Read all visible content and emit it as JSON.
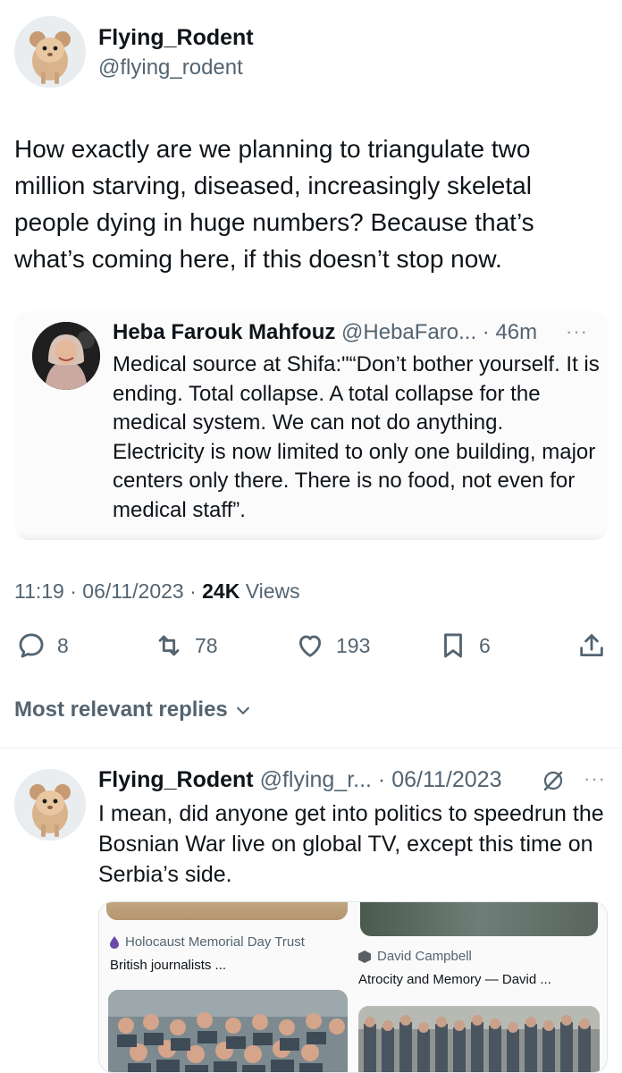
{
  "tweet": {
    "author": {
      "name": "Flying_Rodent",
      "handle": "@flying_rodent"
    },
    "text": "How exactly are we planning to triangulate two million starving, diseased, increasingly skeletal people dying in huge numbers? Because that’s what’s coming here, if this doesn’t stop now.",
    "quoted": {
      "name": "Heba Farouk Mahfouz",
      "meta": "@HebaFaro... · 46m",
      "more": "···",
      "text": "Medical source at Shifa:\"“Don’t bother yourself. It is ending. Total collapse. A total collapse for the medical system. We can not do anything. Electricity is now limited to only one building, major centers only there. There is no food, not even for medical staff”."
    },
    "timestamp": "11:19 · 06/11/2023 · ",
    "views_count": "24K",
    "views_label": " Views",
    "stats": {
      "replies": "8",
      "retweets": "78",
      "likes": "193",
      "bookmarks": "6"
    }
  },
  "replies_sort_label": "Most relevant replies",
  "reply": {
    "name": "Flying_Rodent",
    "meta": "@flying_r... · 06/11/2023",
    "more": "···",
    "text": "I mean, did anyone get into politics to speedrun the Bosnian War live on global TV, except this time on Serbia’s side.",
    "media": [
      {
        "source": "Holocaust Memorial Day Trust",
        "snippet": "British journalists ...",
        "source_icon": "flame-icon"
      },
      {
        "source": "David Campbell",
        "snippet": "Atrocity and Memory — David ...",
        "source_icon": "cube-icon"
      }
    ]
  },
  "colors": {
    "text": "#0f1419",
    "secondary": "#536471",
    "divider": "#eff3f4"
  }
}
